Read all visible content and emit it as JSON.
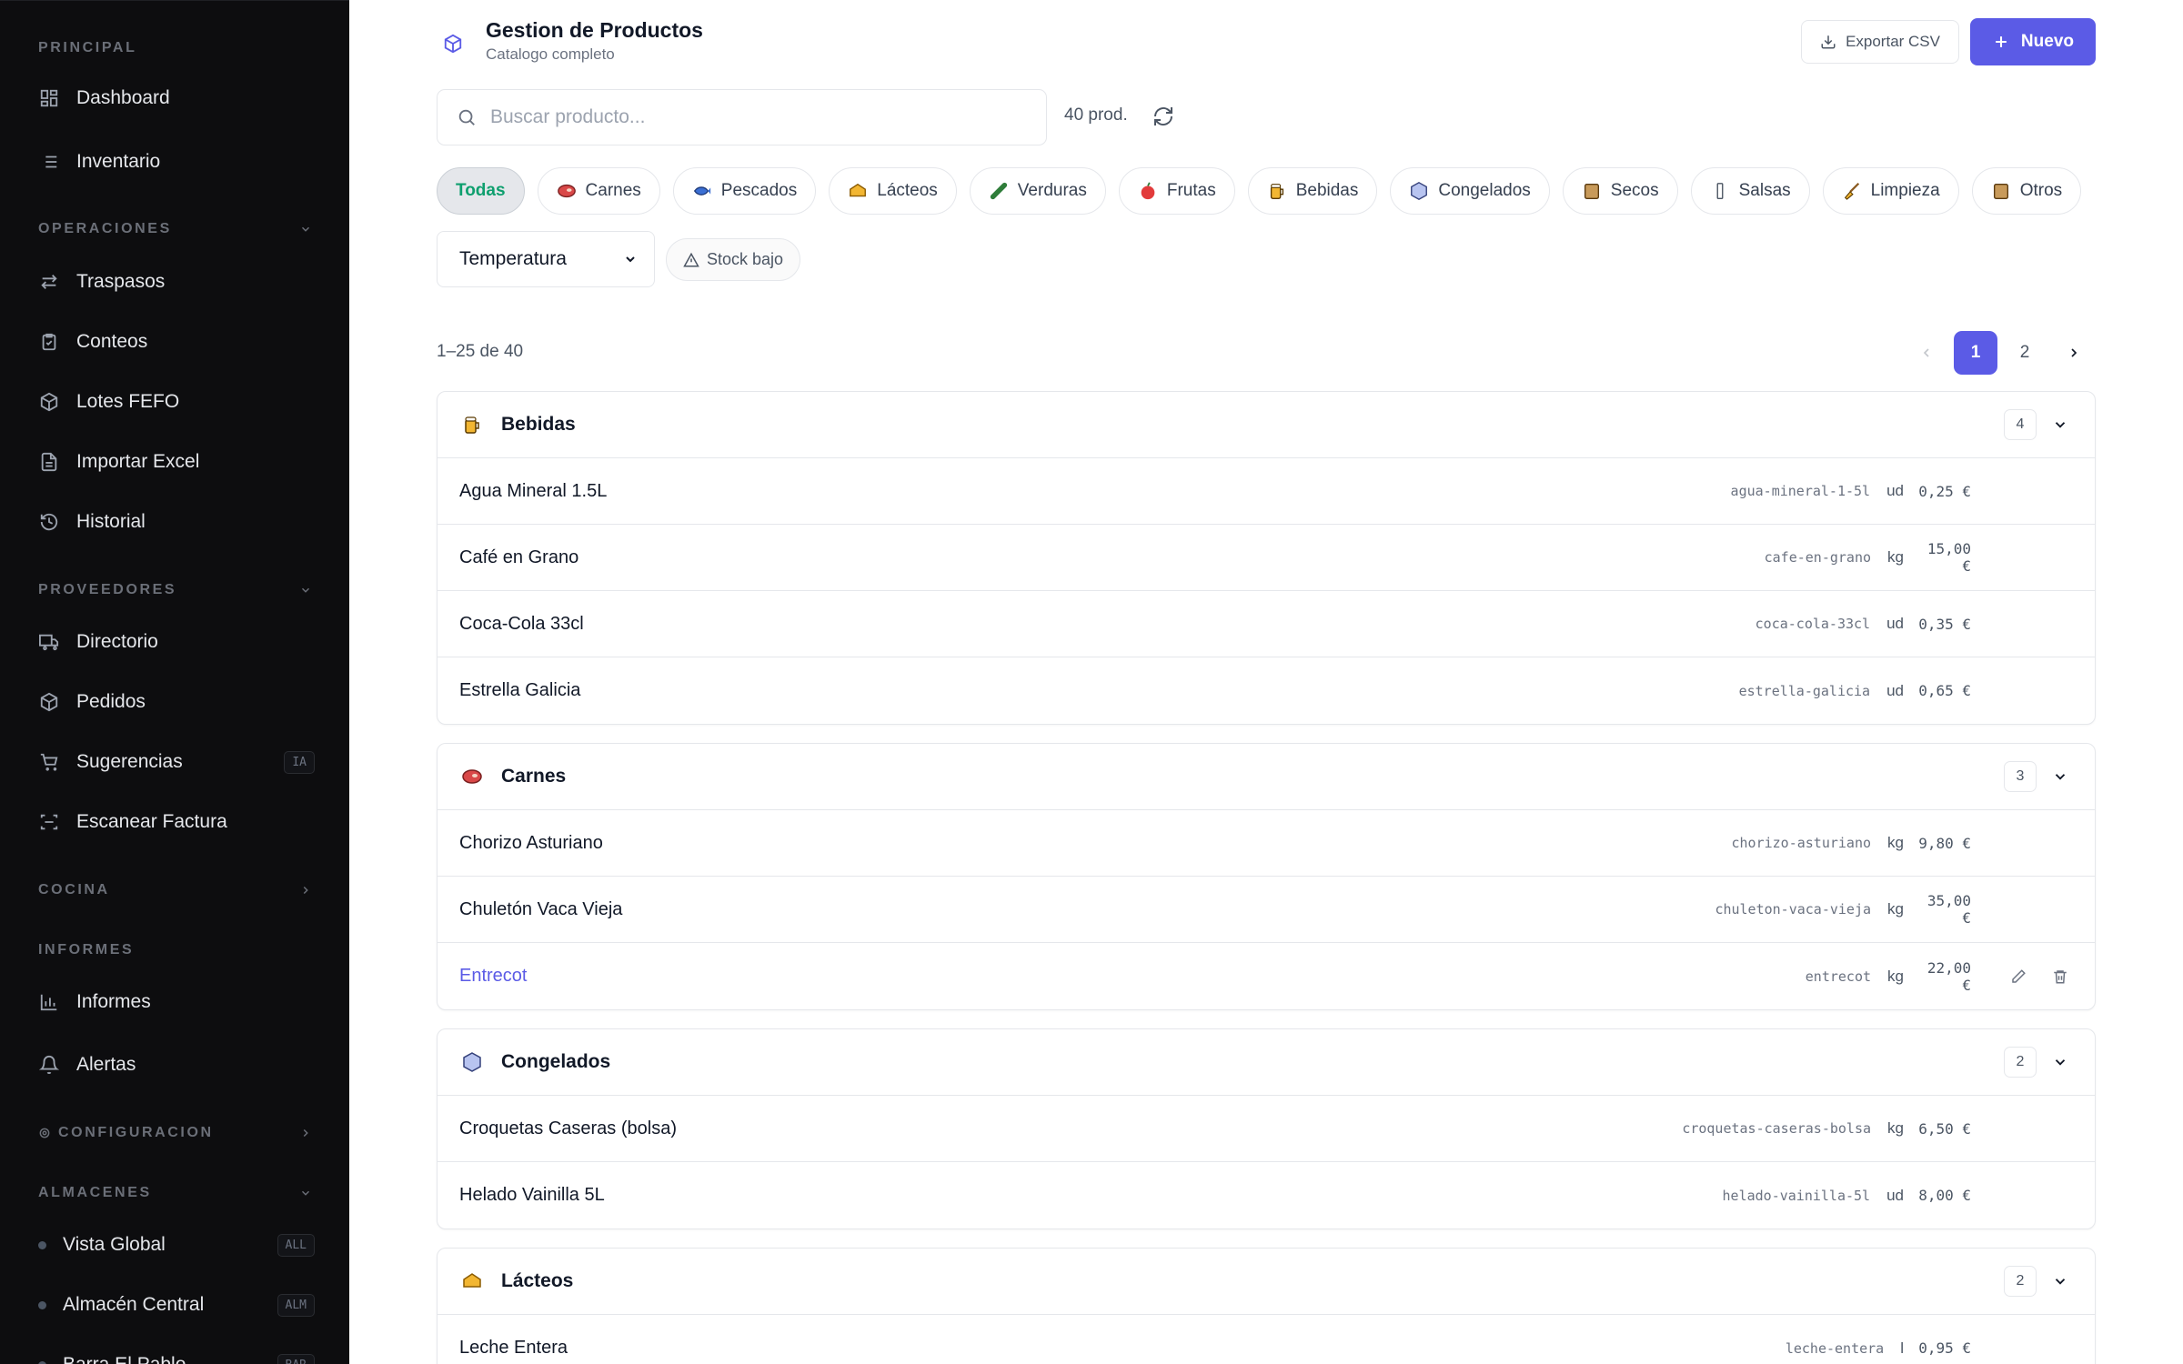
{
  "sidebar": {
    "sections": {
      "principal": "PRINCIPAL",
      "operaciones": "OPERACIONES",
      "proveedores": "PROVEEDORES",
      "cocina": "COCINA",
      "informes": "INFORMES",
      "configuracion": "CONFIGURACION",
      "almacenes": "ALMACENES"
    },
    "items": {
      "dashboard": "Dashboard",
      "inventario": "Inventario",
      "traspasos": "Traspasos",
      "conteos": "Conteos",
      "lotes": "Lotes FEFO",
      "importar": "Importar Excel",
      "historial": "Historial",
      "directorio": "Directorio",
      "pedidos": "Pedidos",
      "sugerencias": "Sugerencias",
      "sugerencias_badge": "IA",
      "escanear": "Escanear Factura",
      "informes": "Informes",
      "alertas": "Alertas"
    },
    "warehouses": [
      {
        "label": "Vista Global",
        "badge": "ALL"
      },
      {
        "label": "Almacén Central",
        "badge": "ALM"
      },
      {
        "label": "Barra El Pablo",
        "badge": "BAR"
      }
    ]
  },
  "header": {
    "title": "Gestion de Productos",
    "subtitle": "Catalogo completo",
    "export_label": "Exportar CSV",
    "new_label": "Nuevo"
  },
  "search": {
    "placeholder": "Buscar producto...",
    "count": "40 prod."
  },
  "chips": [
    "Todas",
    "Carnes",
    "Pescados",
    "Lácteos",
    "Verduras",
    "Frutas",
    "Bebidas",
    "Congelados",
    "Secos",
    "Salsas",
    "Limpieza",
    "Otros"
  ],
  "filters": {
    "temperature": "Temperatura",
    "stock_low": "Stock bajo"
  },
  "pagination": {
    "range": "1–25 de 40",
    "pages": [
      "1",
      "2"
    ],
    "current": "1"
  },
  "groups": [
    {
      "name": "Bebidas",
      "count": "4",
      "icon": "beer-icon",
      "products": [
        {
          "name": "Agua Mineral 1.5L",
          "slug": "agua-mineral-1-5l",
          "unit": "ud",
          "price": "0,25 €"
        },
        {
          "name": "Café en Grano",
          "slug": "cafe-en-grano",
          "unit": "kg",
          "price": "15,00 €"
        },
        {
          "name": "Coca-Cola 33cl",
          "slug": "coca-cola-33cl",
          "unit": "ud",
          "price": "0,35 €"
        },
        {
          "name": "Estrella Galicia",
          "slug": "estrella-galicia",
          "unit": "ud",
          "price": "0,65 €"
        }
      ]
    },
    {
      "name": "Carnes",
      "count": "3",
      "icon": "meat-icon",
      "products": [
        {
          "name": "Chorizo Asturiano",
          "slug": "chorizo-asturiano",
          "unit": "kg",
          "price": "9,80 €"
        },
        {
          "name": "Chuletón Vaca Vieja",
          "slug": "chuleton-vaca-vieja",
          "unit": "kg",
          "price": "35,00 €"
        },
        {
          "name": "Entrecot",
          "slug": "entrecot",
          "unit": "kg",
          "price": "22,00 €"
        }
      ]
    },
    {
      "name": "Congelados",
      "count": "2",
      "icon": "ice-icon",
      "products": [
        {
          "name": "Croquetas Caseras (bolsa)",
          "slug": "croquetas-caseras-bolsa",
          "unit": "kg",
          "price": "6,50 €"
        },
        {
          "name": "Helado Vainilla 5L",
          "slug": "helado-vainilla-5l",
          "unit": "ud",
          "price": "8,00 €"
        }
      ]
    },
    {
      "name": "Lácteos",
      "count": "2",
      "icon": "cheese-icon",
      "products": [
        {
          "name": "Leche Entera",
          "slug": "leche-entera",
          "unit": "l",
          "price": "0,95 €"
        }
      ]
    }
  ],
  "colors": {
    "accent": "#5b5be6",
    "active_chip_text": "#0e9f6e",
    "sidebar_bg": "#0d0d0f"
  }
}
